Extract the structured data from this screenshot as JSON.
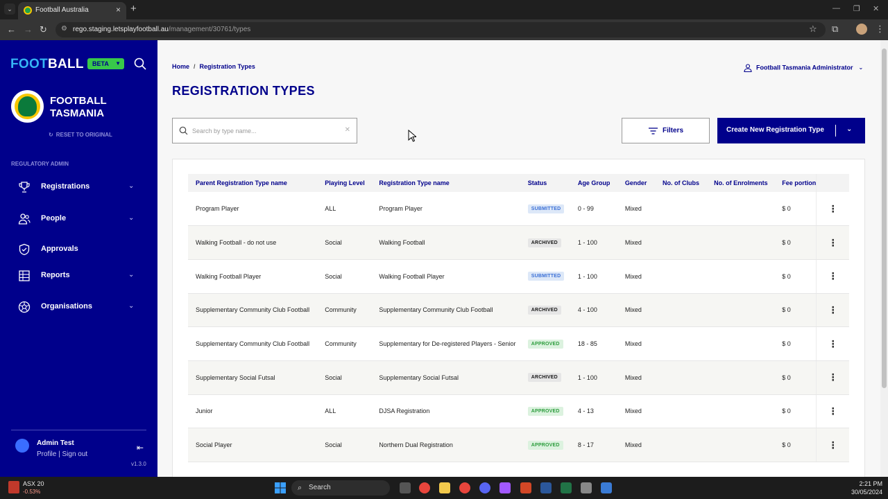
{
  "browser": {
    "tab_title": "Football Australia",
    "url_host": "rego.staging.letsplayfootball.au",
    "url_path": "/management/30761/types"
  },
  "sidebar": {
    "logo_part1": "FOOT",
    "logo_part2": "BALL",
    "beta_label": "BETA",
    "org_name": "FOOTBALL TASMANIA",
    "reset_label": "RESET TO ORIGINAL",
    "section_label": "REGULATORY ADMIN",
    "items": [
      {
        "label": "Registrations",
        "icon": "trophy-icon"
      },
      {
        "label": "People",
        "icon": "people-icon"
      },
      {
        "label": "Approvals",
        "icon": "shield-check-icon"
      },
      {
        "label": "Reports",
        "icon": "table-icon"
      },
      {
        "label": "Organisations",
        "icon": "soccer-ball-icon"
      }
    ],
    "user_name": "Admin Test",
    "user_links": "Profile | Sign out",
    "version": "v1.3.0"
  },
  "main": {
    "breadcrumb_home": "Home",
    "breadcrumb_sep": "/",
    "breadcrumb_current": "Registration Types",
    "title": "REGISTRATION TYPES",
    "admin_label": "Football Tasmania Administrator",
    "search_placeholder": "Search by type name...",
    "filters_label": "Filters",
    "create_label": "Create New Registration Type"
  },
  "table": {
    "headers": [
      "Parent Registration Type name",
      "Playing Level",
      "Registration Type name",
      "Status",
      "Age Group",
      "Gender",
      "No. of Clubs",
      "No. of Enrolments",
      "Fee portion"
    ],
    "rows": [
      {
        "parent": "Program Player",
        "level": "ALL",
        "name": "Program Player",
        "status": "SUBMITTED",
        "age": "0 - 99",
        "gender": "Mixed",
        "clubs": "",
        "enrolments": "",
        "fee": "$ 0"
      },
      {
        "parent": "Walking Football - do not use",
        "level": "Social",
        "name": "Walking Football",
        "status": "ARCHIVED",
        "age": "1 - 100",
        "gender": "Mixed",
        "clubs": "",
        "enrolments": "",
        "fee": "$ 0"
      },
      {
        "parent": "Walking Football Player",
        "level": "Social",
        "name": "Walking Football Player",
        "status": "SUBMITTED",
        "age": "1 - 100",
        "gender": "Mixed",
        "clubs": "",
        "enrolments": "",
        "fee": "$ 0"
      },
      {
        "parent": "Supplementary Community Club Football",
        "level": "Community",
        "name": "Supplementary Community Club Football",
        "status": "ARCHIVED",
        "age": "4 - 100",
        "gender": "Mixed",
        "clubs": "",
        "enrolments": "",
        "fee": "$ 0"
      },
      {
        "parent": "Supplementary Community Club Football",
        "level": "Community",
        "name": "Supplementary for De-registered Players - Senior",
        "status": "APPROVED",
        "age": "18 - 85",
        "gender": "Mixed",
        "clubs": "",
        "enrolments": "",
        "fee": "$ 0"
      },
      {
        "parent": "Supplementary Social Futsal",
        "level": "Social",
        "name": "Supplementary Social Futsal",
        "status": "ARCHIVED",
        "age": "1 - 100",
        "gender": "Mixed",
        "clubs": "",
        "enrolments": "",
        "fee": "$ 0"
      },
      {
        "parent": "Junior",
        "level": "ALL",
        "name": "DJSA Registration",
        "status": "APPROVED",
        "age": "4 - 13",
        "gender": "Mixed",
        "clubs": "",
        "enrolments": "",
        "fee": "$ 0"
      },
      {
        "parent": "Social Player",
        "level": "Social",
        "name": "Northern Dual Registration",
        "status": "APPROVED",
        "age": "8 - 17",
        "gender": "Mixed",
        "clubs": "",
        "enrolments": "",
        "fee": "$ 0"
      }
    ]
  },
  "taskbar": {
    "ticker_name": "ASX 20",
    "ticker_change": "-0.53%",
    "search_label": "Search",
    "time": "2:21 PM",
    "date": "30/05/2024"
  },
  "colors": {
    "brand_navy": "#00008b",
    "beta_green": "#38c84a",
    "logo_light_blue": "#36b5f5"
  }
}
